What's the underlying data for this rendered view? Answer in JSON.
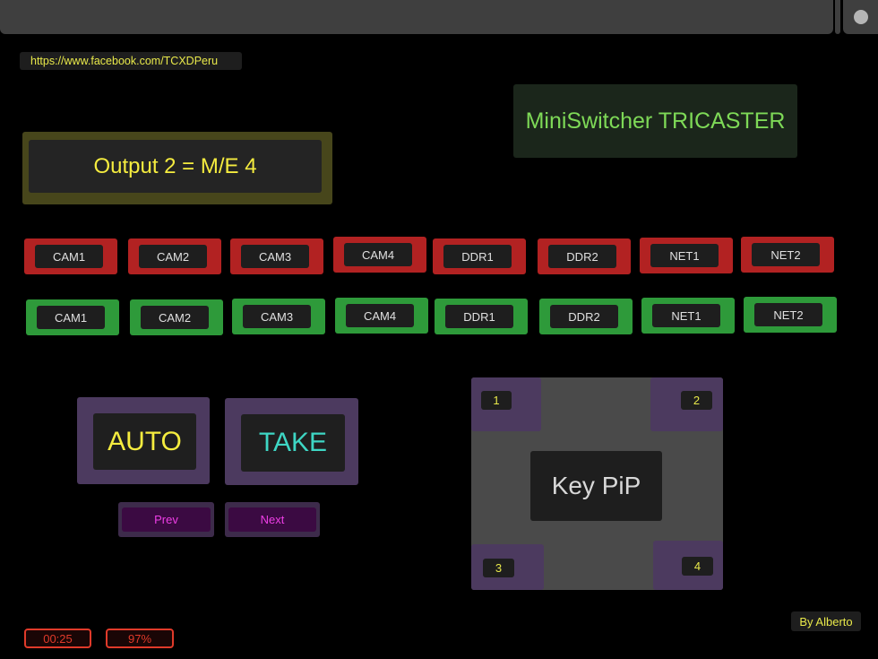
{
  "header": {
    "url": "https://www.facebook.com/TCXDPeru"
  },
  "app": {
    "title": "MiniSwitcher TRICASTER"
  },
  "output": {
    "label": "Output 2 = M/E 4"
  },
  "program_row": [
    "CAM1",
    "CAM2",
    "CAM3",
    "CAM4",
    "DDR1",
    "DDR2",
    "NET1",
    "NET2"
  ],
  "preview_row": [
    "CAM1",
    "CAM2",
    "CAM3",
    "CAM4",
    "DDR1",
    "DDR2",
    "NET1",
    "NET2"
  ],
  "transition": {
    "auto": "AUTO",
    "take": "TAKE",
    "prev": "Prev",
    "next": "Next"
  },
  "pip": {
    "key_label": "Key PiP",
    "corners": [
      "1",
      "2",
      "3",
      "4"
    ]
  },
  "status": {
    "time": "00:25",
    "battery": "97%"
  },
  "credit": "By Alberto",
  "colors": {
    "program": "#b22222",
    "preview": "#2e9a3a",
    "title_text": "#7ed957",
    "output_text": "#f5ec3f",
    "auto_text": "#f5ec3f",
    "take_text": "#3ed6c4",
    "nav_text": "#ee3ee6",
    "status": "#e03a2a"
  },
  "icons": {
    "top_right": "circle-icon"
  }
}
